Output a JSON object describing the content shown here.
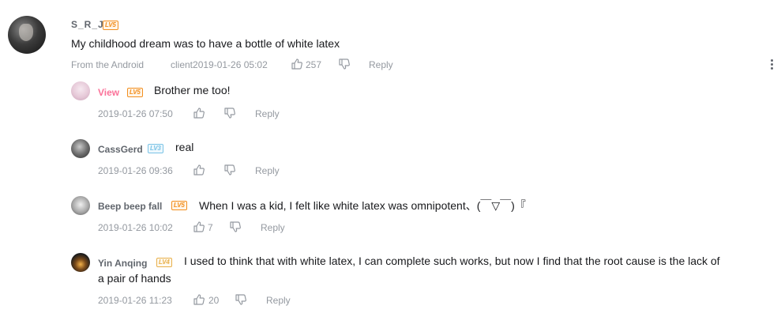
{
  "main_comment": {
    "username": "S_R_J",
    "level": "LV5",
    "text": "My childhood dream was to have a bottle of white latex",
    "source": "From the Android",
    "client_time": "client2019-01-26 05:02",
    "likes": "257",
    "reply_label": "Reply"
  },
  "replies": [
    {
      "username": "View",
      "level": "LV5",
      "text": "Brother me too!",
      "time": "2019-01-26 07:50",
      "likes": "",
      "reply_label": "Reply"
    },
    {
      "username": "CassGerd",
      "level": "LV3",
      "text": "real",
      "time": "2019-01-26 09:36",
      "likes": "",
      "reply_label": "Reply"
    },
    {
      "username": "Beep beep fall",
      "level": "LV5",
      "text": "When I was a kid, I felt like white latex was omnipotent、(￣▽￣)『",
      "time": "2019-01-26 10:02",
      "likes": "7",
      "reply_label": "Reply"
    },
    {
      "username": "Yin Anqing",
      "level": "LV4",
      "text_line1": "I used to think that with white latex, I can complete such works, but now I find that the root cause is the lack of",
      "text_line2": "a pair of hands",
      "time": "2019-01-26 11:23",
      "likes": "20",
      "reply_label": "Reply"
    }
  ],
  "icons": {
    "like": "thumbs-up-icon",
    "dislike": "thumbs-down-icon",
    "more": "more-vertical-icon"
  },
  "colors": {
    "username_pink": "#fb7299",
    "meta_gray": "#9499a0",
    "level_orange": "#f28f20",
    "level_blue": "#7bc3e6"
  }
}
